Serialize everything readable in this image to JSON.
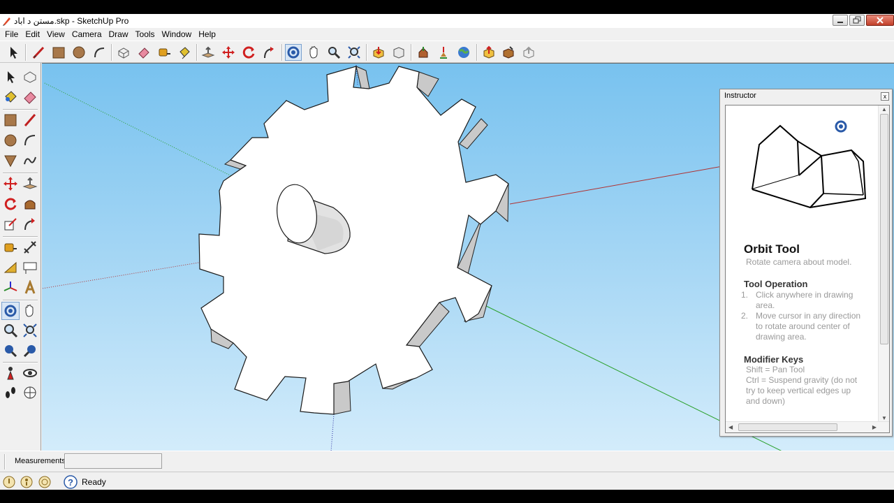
{
  "window": {
    "title": "مستن د اباد.skp - SketchUp Pro"
  },
  "menu": [
    "File",
    "Edit",
    "View",
    "Camera",
    "Draw",
    "Tools",
    "Window",
    "Help"
  ],
  "toolbar": {
    "icons": [
      "select-icon",
      "line-icon",
      "rectangle-icon",
      "circle-icon",
      "arc-icon",
      "make-component-icon",
      "eraser-icon",
      "tape-measure-icon",
      "paint-bucket-icon",
      "push-pull-icon",
      "move-icon",
      "rotate-icon",
      "follow-me-icon",
      "orbit-icon",
      "pan-icon",
      "zoom-icon",
      "zoom-extents-icon",
      "get-models-icon",
      "share-model-icon",
      "share-component-icon",
      "google-earth-icon",
      "get-photo-texture-icon",
      "add-location-icon",
      "toggle-terrain-icon",
      "preview-in-earth-icon"
    ],
    "selected": "orbit-icon"
  },
  "instructor": {
    "header": "Instructor",
    "close_label": "x",
    "tool_title": "Orbit Tool",
    "tool_subtitle": "Rotate camera about model.",
    "operation_heading": "Tool Operation",
    "steps": [
      {
        "num": "1.",
        "text": "Click anywhere in drawing area."
      },
      {
        "num": "2.",
        "text": "Move cursor in any direction to rotate around center of drawing area."
      }
    ],
    "modifier_heading": "Modifier Keys",
    "modifier_lines": [
      "Shift = Pan Tool",
      "Ctrl = Suspend gravity (do not try to keep vertical edges up and down)"
    ]
  },
  "measurements": {
    "label": "Measurements",
    "value": ""
  },
  "status": {
    "text": "Ready"
  },
  "colors": {
    "sky_top": "#78c2ef",
    "red_axis": "#b03030",
    "green_axis": "#2aa02a",
    "blue_axis": "#2a2aa0",
    "selection": "#d8e6f5"
  }
}
